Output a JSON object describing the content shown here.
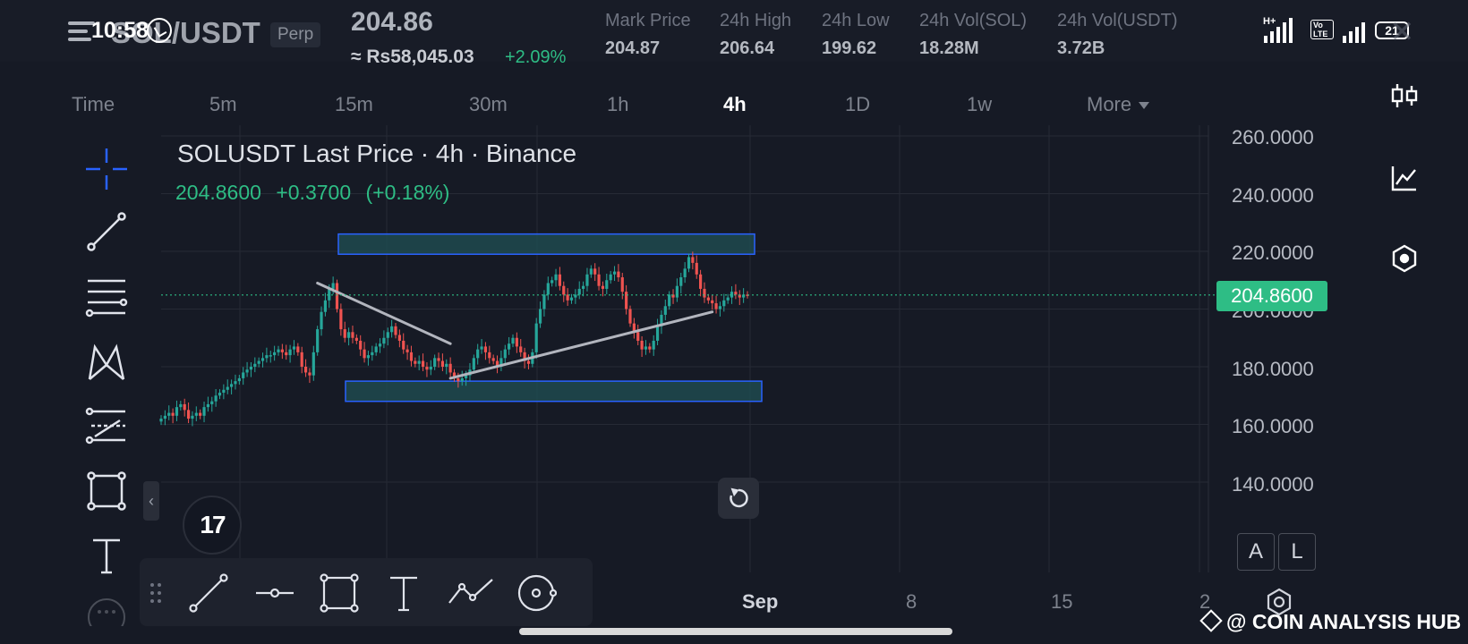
{
  "status_bar": {
    "time": "10:58",
    "network_1": "H+",
    "network_2": "Vo LTE",
    "battery": "21"
  },
  "header": {
    "pair": "SOL/USDT",
    "contract_type": "Perp",
    "last_price": "204.86",
    "fiat_price": "≈ Rs58,045.03",
    "change_pct": "+2.09%",
    "stats": [
      {
        "label": "Mark Price",
        "value": "204.87"
      },
      {
        "label": "24h High",
        "value": "206.64"
      },
      {
        "label": "24h Low",
        "value": "199.62"
      },
      {
        "label": "24h Vol(SOL)",
        "value": "18.28M"
      },
      {
        "label": "24h Vol(USDT)",
        "value": "3.72B"
      }
    ]
  },
  "timeframes": [
    {
      "label": "Time",
      "active": false
    },
    {
      "label": "5m",
      "active": false
    },
    {
      "label": "15m",
      "active": false
    },
    {
      "label": "30m",
      "active": false
    },
    {
      "label": "1h",
      "active": false
    },
    {
      "label": "4h",
      "active": true
    },
    {
      "label": "1D",
      "active": false
    },
    {
      "label": "1w",
      "active": false
    },
    {
      "label": "More",
      "active": false
    }
  ],
  "chart": {
    "title": "SOLUSDT Last Price · 4h · Binance",
    "ohlc": {
      "price": "204.8600",
      "change": "+0.3700",
      "change_pct": "(+0.18%)"
    },
    "current_price_tag": "204.8600",
    "y_axis_labels": [
      "260.0000",
      "240.0000",
      "220.0000",
      "200.0000",
      "180.0000",
      "160.0000",
      "140.0000"
    ],
    "x_axis_labels": [
      "Sep",
      "8",
      "15",
      "2"
    ],
    "scale_buttons": [
      "A",
      "L"
    ],
    "logo_text": "17"
  },
  "chart_data": {
    "type": "candlestick",
    "title": "SOLUSDT Last Price · 4h · Binance",
    "ylim": [
      128,
      268
    ],
    "last_price": 204.86,
    "colors": {
      "up": "#26a69a",
      "down": "#ef5350",
      "zone_fill": "#1f4a4f",
      "zone_border": "#2962ff",
      "trendline": "#b2b5be"
    },
    "zones": [
      {
        "top": 226,
        "bottom": 219
      },
      {
        "top": 175,
        "bottom": 168
      }
    ],
    "trendlines": [
      {
        "from": {
          "i": 40,
          "price": 209
        },
        "to": {
          "i": 74,
          "price": 188
        }
      },
      {
        "from": {
          "i": 74,
          "price": 176
        },
        "to": {
          "i": 141,
          "price": 199
        }
      }
    ],
    "closes": [
      162,
      163,
      164,
      163,
      166,
      167,
      165,
      162,
      163,
      164,
      163,
      166,
      167,
      168,
      170,
      171,
      172,
      173,
      174,
      175,
      176,
      178,
      179,
      180,
      181,
      182,
      183,
      184,
      184,
      185,
      186,
      185,
      184,
      186,
      187,
      185,
      180,
      178,
      177,
      185,
      193,
      199,
      203,
      207,
      209,
      200,
      193,
      190,
      192,
      190,
      189,
      186,
      183,
      184,
      185,
      187,
      188,
      190,
      192,
      194,
      191,
      189,
      186,
      185,
      182,
      181,
      182,
      180,
      179,
      180,
      183,
      182,
      180,
      181,
      178,
      176,
      175,
      176,
      177,
      179,
      183,
      186,
      187,
      185,
      183,
      182,
      180,
      183,
      186,
      188,
      190,
      187,
      185,
      182,
      181,
      185,
      195,
      200,
      205,
      209,
      210,
      212,
      208,
      205,
      203,
      204,
      205,
      207,
      208,
      212,
      214,
      212,
      208,
      207,
      210,
      212,
      213,
      211,
      206,
      200,
      195,
      192,
      189,
      186,
      187,
      186,
      189,
      194,
      198,
      201,
      205,
      204,
      208,
      211,
      214,
      218,
      216,
      212,
      207,
      204,
      203,
      202,
      200,
      201,
      203,
      204,
      206,
      205,
      204,
      205,
      204.86
    ]
  },
  "drawing_bar": {
    "tools": [
      "trend-line",
      "horizontal-ray",
      "rectangle",
      "text",
      "path",
      "circle-tool"
    ]
  },
  "watermark": "@ COIN ANALYSIS HUB"
}
